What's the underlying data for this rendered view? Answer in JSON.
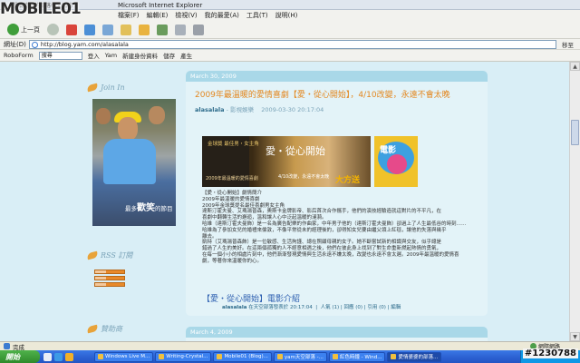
{
  "watermark": {
    "logo": "MOBILE01",
    "id": "#1230788"
  },
  "window": {
    "title": "Microsoft Internet Explorer",
    "title_prefix": "愛情婆婆的部落格 - 網誌"
  },
  "menu": [
    "檔案(F)",
    "編輯(E)",
    "檢視(V)",
    "我的最愛(A)",
    "工具(T)",
    "說明(H)"
  ],
  "toolbar": {
    "back": "上一頁",
    "forward": "",
    "stop": "",
    "refresh": "",
    "home": "",
    "search": "",
    "favorites": "",
    "history": ""
  },
  "address": {
    "label": "網址(D)",
    "url": "http://blog.yam.com/alasalala",
    "go": "移至"
  },
  "links": {
    "robo": "RoboForm",
    "search": "搜尋",
    "join": "登入",
    "yam": "Yam",
    "newbie": "新建身份資料",
    "save": "儲存",
    "gen": "產生"
  },
  "sidebar": {
    "join_title": "Join In",
    "caption_small": "最多",
    "caption_big": "歡笑",
    "caption_tail": "的節目",
    "rss_title": "RSS 訂閱",
    "sponsor_title": "贊助商"
  },
  "post": {
    "date": "March 30, 2009",
    "title": "2009年最溫暖的愛情喜劇【愛・從心開始】，4/10改變，永遠不會太晚",
    "author": "alasalala",
    "category": "影視娛樂",
    "time": "2009-03-30 20:17:04",
    "banner": {
      "award": "金球獎 最佳男・女主角",
      "movie_name": "愛・從心開始",
      "subtitle": "2009年最溫暖的愛情喜劇",
      "release": "4/10改變，永遠不會太晚",
      "big": "大方送"
    },
    "poster_text": "電影",
    "body": [
      "【愛・從心開始】劇情簡介",
      "2009年最溫暖的愛情喜劇",
      "2009年金球獎提名最佳喜劇男女主角",
      "達斯汀霍夫曼、艾瑪湯普森，奧斯卡金牌影帝、影后首次合作攜手，他們的演技經驗造就這對片的不平凡，在",
      "喜劇中翻轉生活的邂逅，溫和讓人心中泛起溫暖的漣漪。",
      "哈維（達斯汀霍夫曼飾）是一名為廣告配樂的作曲家，中年男子他的（達斯汀霍夫曼飾）卻過上了人生最低谷的時刻……",
      "哈維為了參加女兒的婚禮來倫敦，不像平常從未的經理後的，卻得知女兒要由繼父領上紅毯，讓他的失落與幾乎",
      "離去。",
      "凱特（艾瑪湯普森飾）是一位敏感、生活拘謹、總在照顧母親的女子。她不斷嘗試新的相識與交友，似乎總是",
      "錯過了人生的美好。在這兩個孤獨的人不經意相遇之後，他們在彼此身上找到了對生命重新燃起熱情的勇氣，",
      "在每一個小小的相處片刻中，他們漸漸發現愛情與生活永遠不嫌太晚，改變也永遠不會太遲。2009年最溫暖的愛情喜",
      "劇，等著你來溫暖你的心。"
    ],
    "link": "【愛・從心開始】電影介紹",
    "footer_author": "alasalala",
    "footer_text": "在天空部落發表於",
    "footer_time": "20:17:04",
    "footer_stats": "人氣 (1) | 回應 (0) | 引用 (0) | 編輯"
  },
  "post2": {
    "date": "March 4, 2009"
  },
  "status": {
    "text": "完成",
    "zone": "網際網路"
  },
  "taskbar": {
    "start": "開始",
    "tasks": [
      {
        "label": "Windows Live M..."
      },
      {
        "label": "Writing-Crystal..."
      },
      {
        "label": "Mobile01 (Blog)..."
      },
      {
        "label": "yam天空部落 -..."
      },
      {
        "label": "紅色時鐘 - Wind..."
      },
      {
        "label": "愛情婆婆的部落...",
        "active": true
      }
    ]
  }
}
